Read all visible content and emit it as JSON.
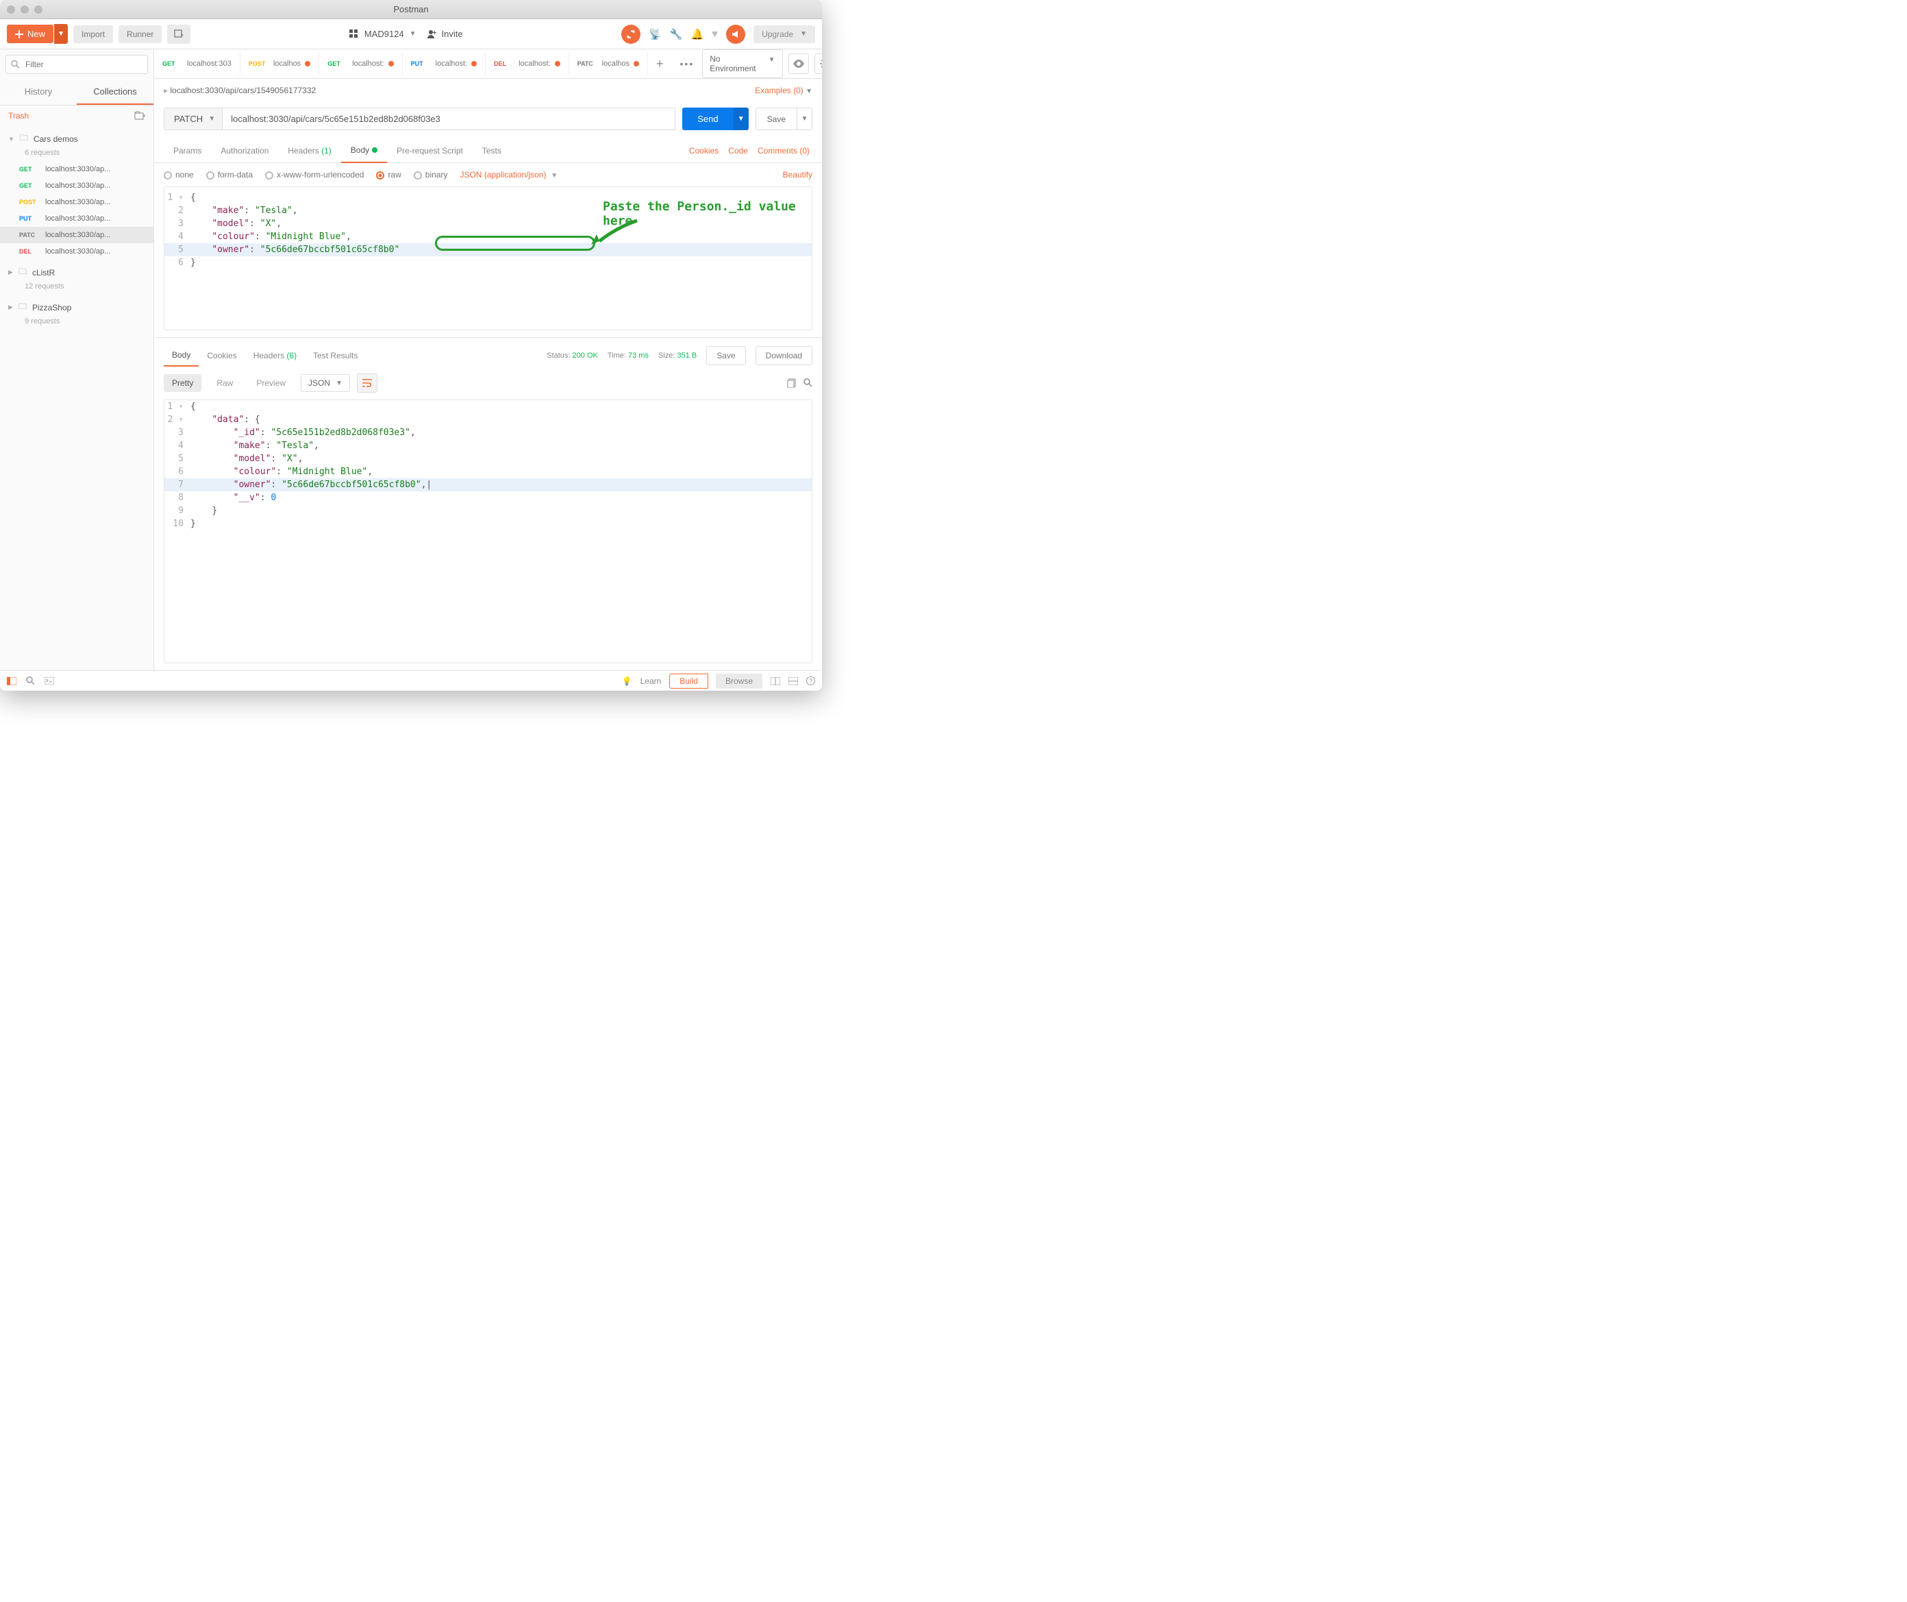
{
  "window": {
    "title": "Postman"
  },
  "toolbar": {
    "new_label": "New",
    "import_label": "Import",
    "runner_label": "Runner",
    "workspace_name": "MAD9124",
    "invite_label": "Invite",
    "upgrade_label": "Upgrade"
  },
  "sidebar": {
    "filter_placeholder": "Filter",
    "tabs": {
      "history": "History",
      "collections": "Collections"
    },
    "trash_label": "Trash",
    "folders": [
      {
        "name": "Cars demos",
        "count": "6 requests",
        "expanded": true,
        "requests": [
          {
            "method": "GET",
            "cls": "m-get",
            "label": "localhost:3030/ap..."
          },
          {
            "method": "GET",
            "cls": "m-get",
            "label": "localhost:3030/ap..."
          },
          {
            "method": "POST",
            "cls": "m-post",
            "label": "localhost:3030/ap..."
          },
          {
            "method": "PUT",
            "cls": "m-put",
            "label": "localhost:3030/ap..."
          },
          {
            "method": "PATC",
            "cls": "m-patc",
            "label": "localhost:3030/ap...",
            "selected": true
          },
          {
            "method": "DEL",
            "cls": "m-del",
            "label": "localhost:3030/ap..."
          }
        ]
      },
      {
        "name": "cListR",
        "count": "12 requests",
        "expanded": false
      },
      {
        "name": "PizzaShop",
        "count": "9 requests",
        "expanded": false
      }
    ]
  },
  "tabs": [
    {
      "method": "GET",
      "cls": "m-get",
      "label": "localhost:303"
    },
    {
      "method": "POST",
      "cls": "m-post",
      "label": "localhos",
      "dot": true
    },
    {
      "method": "GET",
      "cls": "m-get",
      "label": "localhost:",
      "dot": true
    },
    {
      "method": "PUT",
      "cls": "m-put",
      "label": "localhost:",
      "dot": true
    },
    {
      "method": "DEL",
      "cls": "m-del",
      "label": "localhost:",
      "dot": true
    },
    {
      "method": "PATC",
      "cls": "m-patc",
      "label": "localhos",
      "dot": true,
      "active": true
    }
  ],
  "env": {
    "label": "No Environment"
  },
  "breadcrumb": "localhost:3030/api/cars/1549056177332",
  "examples": "Examples (0)",
  "request": {
    "method": "PATCH",
    "url": "localhost:3030/api/cars/5c65e151b2ed8b2d068f03e3",
    "send": "Send",
    "save": "Save",
    "subtabs": {
      "params": "Params",
      "authorization": "Authorization",
      "headers": "Headers",
      "headers_count": "(1)",
      "body": "Body",
      "prerequest": "Pre-request Script",
      "tests": "Tests"
    },
    "links": {
      "cookies": "Cookies",
      "code": "Code",
      "comments": "Comments (0)"
    },
    "body_types": {
      "none": "none",
      "formdata": "form-data",
      "xwww": "x-www-form-urlencoded",
      "raw": "raw",
      "binary": "binary"
    },
    "content_type": "JSON (application/json)",
    "beautify": "Beautify",
    "body_json": {
      "make": "Tesla",
      "model": "X",
      "colour": "Midnight Blue",
      "owner": "5c66de67bccbf501c65cf8b0"
    },
    "annotation": "Paste the Person._id value here"
  },
  "response": {
    "tabs": {
      "body": "Body",
      "cookies": "Cookies",
      "headers": "Headers",
      "headers_count": "(6)",
      "testresults": "Test Results"
    },
    "status_label": "Status:",
    "status_value": "200 OK",
    "time_label": "Time:",
    "time_value": "73 ms",
    "size_label": "Size:",
    "size_value": "351 B",
    "save": "Save",
    "download": "Download",
    "toolbar": {
      "pretty": "Pretty",
      "raw": "Raw",
      "preview": "Preview",
      "json": "JSON"
    },
    "body": {
      "data": {
        "_id": "5c65e151b2ed8b2d068f03e3",
        "make": "Tesla",
        "model": "X",
        "colour": "Midnight Blue",
        "owner": "5c66de67bccbf501c65cf8b0",
        "__v": 0
      }
    }
  },
  "statusbar": {
    "learn": "Learn",
    "build": "Build",
    "browse": "Browse"
  }
}
